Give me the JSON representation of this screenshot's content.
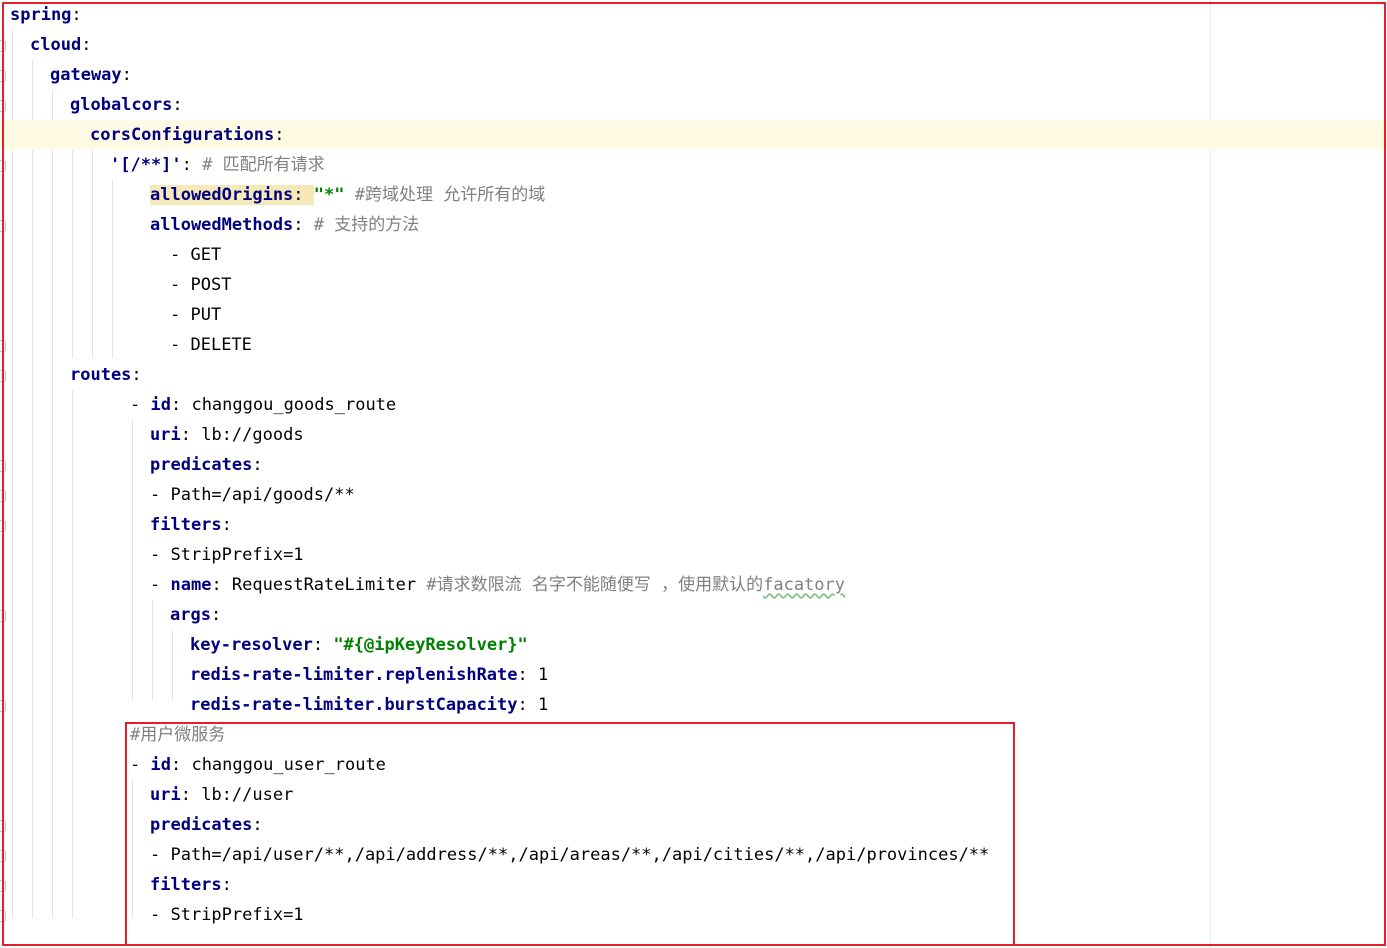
{
  "editor": {
    "language": "yaml",
    "colors": {
      "key": "#000080",
      "comment": "#808080",
      "string": "#008000",
      "current_line": "#fffae3",
      "highlight_box": "#e0202a"
    },
    "lines": [
      [
        {
          "t": "k",
          "x": "spring"
        },
        {
          "t": "p",
          "x": ":"
        }
      ],
      [
        {
          "t": "k",
          "x": "cloud"
        },
        {
          "t": "p",
          "x": ":"
        }
      ],
      [
        {
          "t": "k",
          "x": "gateway"
        },
        {
          "t": "p",
          "x": ":"
        }
      ],
      [
        {
          "t": "k",
          "x": "globalcors"
        },
        {
          "t": "p",
          "x": ":"
        }
      ],
      [
        {
          "t": "k",
          "x": "corsConfigurations"
        },
        {
          "t": "p",
          "x": ":"
        }
      ],
      [
        {
          "t": "k",
          "x": "'[/**]'"
        },
        {
          "t": "p",
          "x": ": "
        },
        {
          "t": "c",
          "x": "# 匹配所有请求"
        }
      ],
      [
        {
          "t": "k",
          "x": "allowedOrigins",
          "hl": true
        },
        {
          "t": "p",
          "x": ": ",
          "hl": true
        },
        {
          "t": "s",
          "x": "\"*\""
        },
        {
          "t": "c",
          "x": " #跨域处理 允许所有的域"
        }
      ],
      [
        {
          "t": "k",
          "x": "allowedMethods"
        },
        {
          "t": "p",
          "x": ": "
        },
        {
          "t": "c",
          "x": "# 支持的方法"
        }
      ],
      [
        {
          "t": "p",
          "x": "- "
        },
        {
          "t": "v",
          "x": "GET"
        }
      ],
      [
        {
          "t": "p",
          "x": "- "
        },
        {
          "t": "v",
          "x": "POST"
        }
      ],
      [
        {
          "t": "p",
          "x": "- "
        },
        {
          "t": "v",
          "x": "PUT"
        }
      ],
      [
        {
          "t": "p",
          "x": "- "
        },
        {
          "t": "v",
          "x": "DELETE"
        }
      ],
      [
        {
          "t": "k",
          "x": "routes"
        },
        {
          "t": "p",
          "x": ":"
        }
      ],
      [
        {
          "t": "p",
          "x": "- "
        },
        {
          "t": "k",
          "x": "id"
        },
        {
          "t": "p",
          "x": ": "
        },
        {
          "t": "v",
          "x": "changgou_goods_route"
        }
      ],
      [
        {
          "t": "k",
          "x": "uri"
        },
        {
          "t": "p",
          "x": ": "
        },
        {
          "t": "v",
          "x": "lb://goods"
        }
      ],
      [
        {
          "t": "k",
          "x": "predicates"
        },
        {
          "t": "p",
          "x": ":"
        }
      ],
      [
        {
          "t": "p",
          "x": "- "
        },
        {
          "t": "v",
          "x": "Path=/api/goods/**"
        }
      ],
      [
        {
          "t": "k",
          "x": "filters"
        },
        {
          "t": "p",
          "x": ":"
        }
      ],
      [
        {
          "t": "p",
          "x": "- "
        },
        {
          "t": "v",
          "x": "StripPrefix=1"
        }
      ],
      [
        {
          "t": "p",
          "x": "- "
        },
        {
          "t": "k",
          "x": "name"
        },
        {
          "t": "p",
          "x": ": "
        },
        {
          "t": "v",
          "x": "RequestRateLimiter "
        },
        {
          "t": "c",
          "x": "#请求数限流 名字不能随便写 ，使用默认的"
        },
        {
          "t": "c",
          "x": "facatory",
          "wavy": true
        }
      ],
      [
        {
          "t": "k",
          "x": "args"
        },
        {
          "t": "p",
          "x": ":"
        }
      ],
      [
        {
          "t": "k",
          "x": "key-resolver"
        },
        {
          "t": "p",
          "x": ": "
        },
        {
          "t": "s",
          "x": "\"#{@ipKeyResolver}\""
        }
      ],
      [
        {
          "t": "k",
          "x": "redis-rate-limiter.replenishRate"
        },
        {
          "t": "p",
          "x": ": "
        },
        {
          "t": "v",
          "x": "1"
        }
      ],
      [
        {
          "t": "k",
          "x": "redis-rate-limiter.burstCapacity"
        },
        {
          "t": "p",
          "x": ": "
        },
        {
          "t": "v",
          "x": "1"
        }
      ],
      [
        {
          "t": "c",
          "x": "#用户微服务"
        }
      ],
      [
        {
          "t": "p",
          "x": "- "
        },
        {
          "t": "k",
          "x": "id"
        },
        {
          "t": "p",
          "x": ": "
        },
        {
          "t": "v",
          "x": "changgou_user_route"
        }
      ],
      [
        {
          "t": "k",
          "x": "uri"
        },
        {
          "t": "p",
          "x": ": "
        },
        {
          "t": "v",
          "x": "lb://user"
        }
      ],
      [
        {
          "t": "k",
          "x": "predicates"
        },
        {
          "t": "p",
          "x": ":"
        }
      ],
      [
        {
          "t": "p",
          "x": "- "
        },
        {
          "t": "v",
          "x": "Path=/api/user/**,/api/address/**,/api/areas/**,/api/cities/**,/api/provinces/**"
        }
      ],
      [
        {
          "t": "k",
          "x": "filters"
        },
        {
          "t": "p",
          "x": ":"
        }
      ],
      [
        {
          "t": "p",
          "x": "- "
        },
        {
          "t": "v",
          "x": "StripPrefix=1"
        }
      ]
    ]
  }
}
